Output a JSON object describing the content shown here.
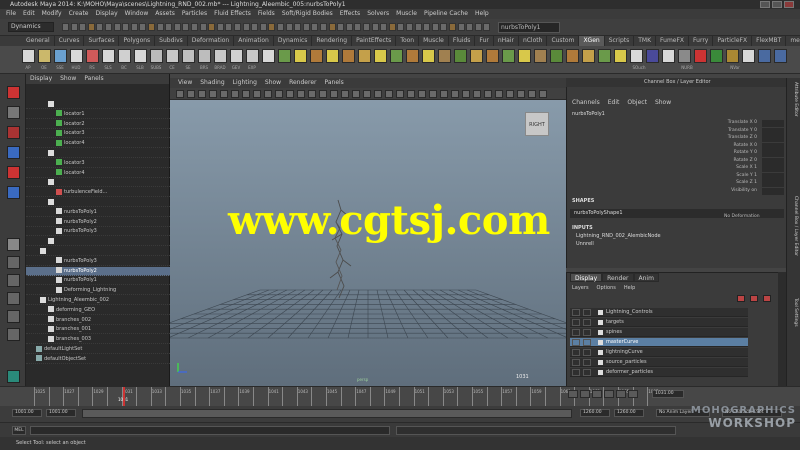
{
  "window": {
    "title": "Autodesk Maya 2014: K:\\MOHO\\Maya\\scenes\\Lightning_RND_002.mb* --- Lightning_Aleembic_005:nurbsToPoly1"
  },
  "menubar": [
    "File",
    "Edit",
    "Modify",
    "Create",
    "Display",
    "Window",
    "Assets",
    "Particles",
    "Fluid Effects",
    "Fields",
    "Soft/Rigid Bodies",
    "Effects",
    "Solvers",
    "Muscle",
    "Pipeline Cache",
    "Help"
  ],
  "statusline": {
    "mode": "Dynamics",
    "name_field": "nurbsToPoly1"
  },
  "shelf": {
    "tabs": [
      "General",
      "Curves",
      "Surfaces",
      "Polygons",
      "Subdivs",
      "Deformation",
      "Animation",
      "Dynamics",
      "Rendering",
      "PaintEffects",
      "Toon",
      "Muscle",
      "Fluids",
      "Fur",
      "nHair",
      "nCloth",
      "Custom",
      "XGen",
      "Scripts",
      "TMK",
      "FumeFX",
      "Furry",
      "ParticleFX",
      "FlexMBT",
      "mel"
    ],
    "active_tab": "XGen",
    "labels": [
      "AP",
      "OE",
      "SSE",
      "HUD",
      "RS",
      "SLS",
      "BC",
      "SLB",
      "SUBS",
      "CE",
      "SE",
      "BRS",
      "BRAD",
      "GEV",
      "EXP"
    ],
    "label_right": [
      "SOuch",
      "NURB",
      "NVar"
    ]
  },
  "outliner": {
    "menu": [
      "Display",
      "Show",
      "Panels"
    ],
    "rows": [
      {
        "label": "",
        "indent": 22,
        "icon": "group"
      },
      {
        "label": "locator1",
        "indent": 30,
        "icon": "locator"
      },
      {
        "label": "locator2",
        "indent": 30,
        "icon": "locator"
      },
      {
        "label": "locator3",
        "indent": 30,
        "icon": "locator"
      },
      {
        "label": "locator4",
        "indent": 30,
        "icon": "locator"
      },
      {
        "label": "",
        "indent": 22,
        "icon": "group"
      },
      {
        "label": "locator3",
        "indent": 30,
        "icon": "locator"
      },
      {
        "label": "locator4",
        "indent": 30,
        "icon": "locator"
      },
      {
        "label": "",
        "indent": 22,
        "icon": "group"
      },
      {
        "label": "turbulenceField...",
        "indent": 30,
        "icon": "field"
      },
      {
        "label": "",
        "indent": 22,
        "icon": "group"
      },
      {
        "label": "nurbsToPoly1",
        "indent": 30,
        "icon": "mesh"
      },
      {
        "label": "nurbsToPoly2",
        "indent": 30,
        "icon": "mesh"
      },
      {
        "label": "nurbsToPoly3",
        "indent": 30,
        "icon": "mesh"
      },
      {
        "label": "",
        "indent": 22,
        "icon": "group"
      },
      {
        "label": "",
        "indent": 14,
        "icon": "group"
      },
      {
        "label": "nurbsToPoly3",
        "indent": 30,
        "icon": "mesh"
      },
      {
        "label": "nurbsToPoly2",
        "indent": 30,
        "icon": "mesh",
        "selected": true
      },
      {
        "label": "nurbsToPoly1",
        "indent": 30,
        "icon": "mesh"
      },
      {
        "label": "Deforming_Lightning",
        "indent": 30,
        "icon": "mesh"
      },
      {
        "label": "Lightning_Aleembic_002",
        "indent": 14,
        "icon": "group"
      },
      {
        "label": "deforming_GEO",
        "indent": 22,
        "icon": "mesh"
      },
      {
        "label": "branches_002",
        "indent": 22,
        "icon": "mesh"
      },
      {
        "label": "branches_001",
        "indent": 22,
        "icon": "mesh"
      },
      {
        "label": "branches_003",
        "indent": 22,
        "icon": "mesh"
      },
      {
        "label": "defaultLightSet",
        "indent": 10,
        "icon": "set"
      },
      {
        "label": "defaultObjectSet",
        "indent": 10,
        "icon": "set"
      }
    ]
  },
  "viewport": {
    "menu": [
      "View",
      "Shading",
      "Lighting",
      "Show",
      "Renderer",
      "Panels"
    ],
    "viewcube_label": "RIGHT",
    "watermark": "www.cgtsj.com",
    "current_frame": "1031",
    "camera_label": "persp"
  },
  "channel_box": {
    "title": "Channel Box / Layer Editor",
    "menu": [
      "Channels",
      "Edit",
      "Object",
      "Show"
    ],
    "object_name": "nurbsToPoly1",
    "attributes": [
      "Translate X 0",
      "Translate Y 0",
      "Translate Z 0",
      "Rotate X 0",
      "Rotate Y 0",
      "Rotate Z 0",
      "Scale X 1",
      "Scale Y 1",
      "Scale Z 1",
      "Visibility on"
    ],
    "shapes_header": "SHAPES",
    "shape_name": "nurbsToPolyShape1",
    "no_deformation": "No Deformation",
    "inputs_header": "INPUTS",
    "inputs": [
      "Lightning_RND_002_AlembicNode",
      "Unnrell"
    ]
  },
  "layer_editor": {
    "tabs": [
      "Display",
      "Render",
      "Anim"
    ],
    "active_tab": "Display",
    "menu": [
      "Layers",
      "Options",
      "Help"
    ],
    "rows": [
      {
        "name": "Lightning_Controls",
        "selected": false
      },
      {
        "name": "targets",
        "selected": false
      },
      {
        "name": "spines",
        "selected": false
      },
      {
        "name": "masterCurve",
        "selected": true
      },
      {
        "name": "lightningCurve",
        "selected": false
      },
      {
        "name": "source_particles",
        "selected": false
      },
      {
        "name": "deformer_particles",
        "selected": false
      }
    ]
  },
  "right_sidebar": [
    "Attribute Editor",
    "Channel Box / Layer Editor",
    "Tool Settings"
  ],
  "timeline": {
    "ticks": [
      "1025",
      "1026",
      "1027",
      "1028",
      "1029",
      "1030",
      "1031",
      "1032",
      "1033",
      "1034",
      "1035",
      "1036",
      "1037",
      "1038",
      "1039",
      "1040",
      "1041",
      "1042",
      "1043",
      "1044",
      "1045",
      "1046",
      "1047",
      "1048",
      "1049",
      "1050",
      "1051",
      "1052",
      "1053",
      "1054",
      "1055",
      "1056",
      "1057",
      "1058",
      "1059",
      "1060",
      "1061",
      "1062",
      "1063",
      "1064",
      "1065",
      "1066",
      "1067"
    ],
    "current_frame": "1031",
    "current_frame_field": "1031.00"
  },
  "range_slider": {
    "start": "1001.00",
    "start2": "1001.00",
    "end": "1260.00",
    "end2": "1260.00",
    "anim_layer": "No Anim Layer",
    "char_set": "No Character Set"
  },
  "help_line": "Select Tool: select an object",
  "logo": {
    "line1": "MOHOGRAPHICS",
    "line2": "WORKSHOP"
  },
  "colors": {
    "accent_select": "#5b7fa3",
    "watermark": "#ffff00",
    "viewport_top": "#8b9eae",
    "viewport_bottom": "#5f6e7c"
  }
}
